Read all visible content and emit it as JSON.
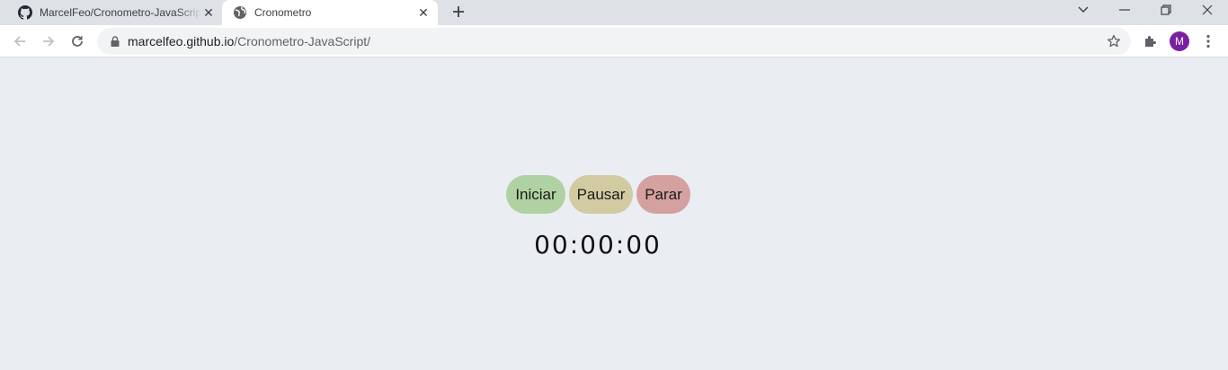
{
  "browser": {
    "tabs": [
      {
        "title": "MarcelFeo/Cronometro-JavaScript",
        "favicon": "github-icon",
        "close": "✕"
      },
      {
        "title": "Cronometro",
        "favicon": "globe-icon",
        "close": "✕"
      }
    ],
    "new_tab": "+",
    "address": {
      "host": "marcelfeo.github.io",
      "path": "/Cronometro-JavaScript/"
    },
    "profile_initial": "M",
    "profile_color": "#7b1fa2"
  },
  "stopwatch": {
    "buttons": {
      "start": "Iniciar",
      "pause": "Pausar",
      "stop": "Parar"
    },
    "colors": {
      "start": "#b0d1a1",
      "pause": "#d2caa1",
      "stop": "#d4a0a0",
      "background": "#eaeef2"
    },
    "time": "00:00:00"
  }
}
